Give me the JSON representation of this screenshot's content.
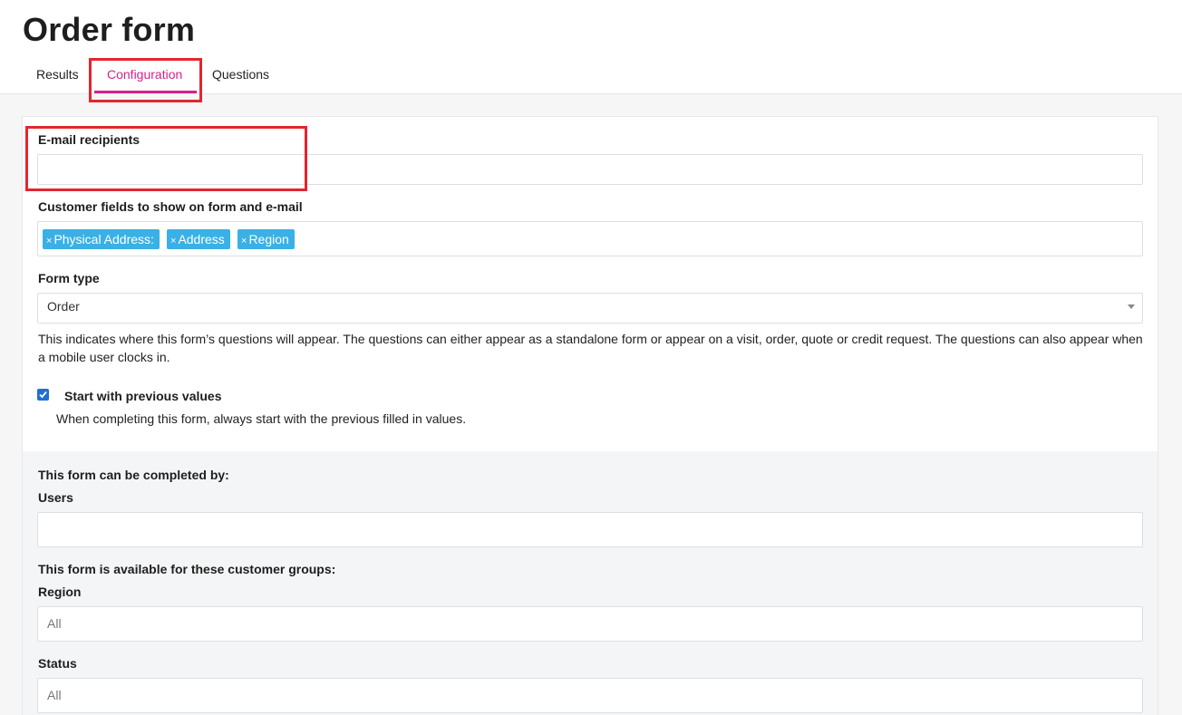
{
  "page": {
    "title": "Order form"
  },
  "tabs": [
    {
      "label": "Results",
      "active": false
    },
    {
      "label": "Configuration",
      "active": true
    },
    {
      "label": "Questions",
      "active": false
    }
  ],
  "email_recipients": {
    "label": "E-mail recipients",
    "value": ""
  },
  "customer_fields": {
    "label": "Customer fields to show on form and e-mail",
    "tags": [
      "Physical Address:",
      "Address",
      "Region"
    ],
    "remove_glyph": "×"
  },
  "form_type": {
    "label": "Form type",
    "value": "Order",
    "help": "This indicates where this form’s questions will appear. The questions can either appear as a standalone form or appear on a visit, order, quote or credit request. The questions can also appear when a mobile user clocks in."
  },
  "start_previous": {
    "label": "Start with previous values",
    "checked": true,
    "help": "When completing this form, always start with the previous filled in values."
  },
  "completed_by": {
    "heading": "This form can be completed by:",
    "users_label": "Users",
    "users_value": ""
  },
  "customer_groups": {
    "heading": "This form is available for these customer groups:",
    "region_label": "Region",
    "region_placeholder": "All",
    "status_label": "Status",
    "status_placeholder": "All"
  },
  "colors": {
    "accent": "#d6218a",
    "tag": "#3ab0e6",
    "checkbox": "#1f6fd1",
    "annotation": "#e3262e"
  }
}
